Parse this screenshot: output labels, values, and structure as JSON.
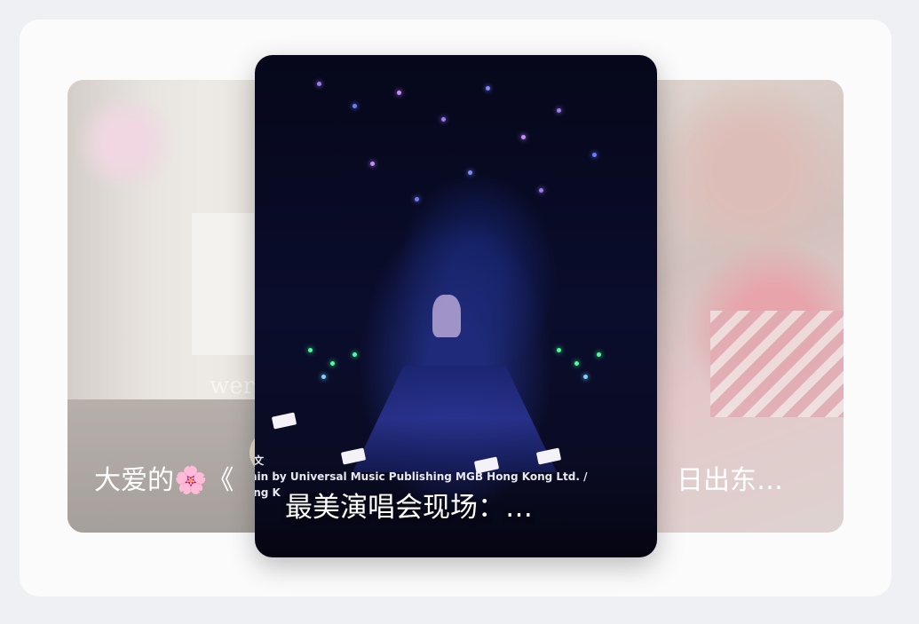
{
  "carousel": {
    "cards": [
      {
        "position": "left",
        "caption": "大爱的🌸《",
        "watermark": "wer"
      },
      {
        "position": "center",
        "caption": "最美演唱会现场：…",
        "credit_line_1": "a文",
        "credit_line_2": "min by Universal Music Publishing MGB Hong Kong Ltd. /",
        "credit_line_3": "ong K"
      },
      {
        "position": "right",
        "caption": "日出东…"
      }
    ]
  }
}
